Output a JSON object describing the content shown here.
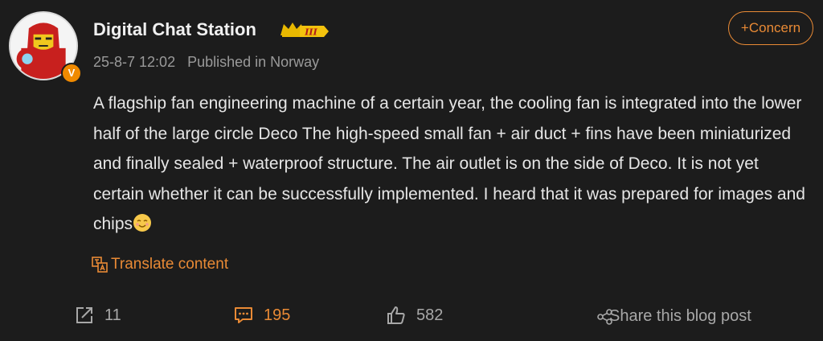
{
  "user": {
    "name": "Digital Chat Station",
    "verified_badge": "V",
    "level_badge": "III",
    "timestamp": "25-8-7 12:02",
    "location": "Published in Norway"
  },
  "follow": {
    "label": "+Concern"
  },
  "post": {
    "text": "A flagship fan engineering machine of a certain year, the cooling fan is integrated into the lower half of the large circle Deco  The high-speed small fan + air duct + fins have been miniaturized and finally sealed + waterproof structure.  The air outlet is on the side of Deco.  It is not yet certain whether it can be successfully implemented.  I heard that it was prepared for images and chips",
    "emoji": "smiling-face-emoji"
  },
  "translate": {
    "label": "Translate content"
  },
  "actions": {
    "repost_count": "11",
    "comment_count": "195",
    "like_count": "582",
    "share_label": "Share this blog post"
  },
  "colors": {
    "accent": "#e98a35",
    "background": "#1c1c1c",
    "text": "#e6e6e6",
    "muted": "#9a9a9a"
  }
}
